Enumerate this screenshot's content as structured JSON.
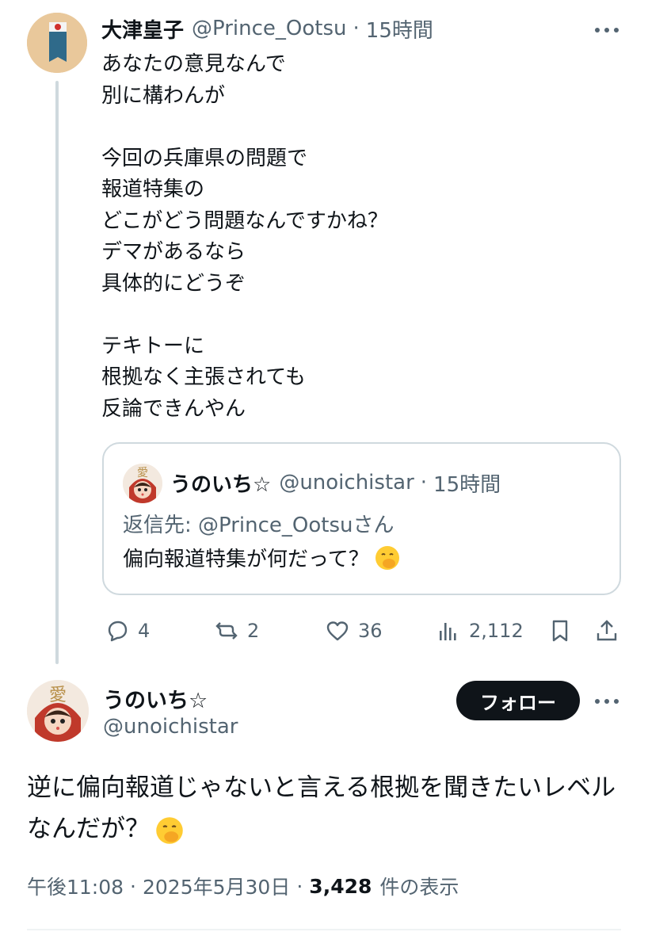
{
  "parent_tweet": {
    "author_name": "大津皇子",
    "handle": "@Prince_Ootsu",
    "separator": "·",
    "time": "15時間",
    "body_lines": [
      "あなたの意見なんで",
      "別に構わんが",
      "",
      "今回の兵庫県の問題で",
      "報道特集の",
      "どこがどう問題なんですかね？",
      "デマがあるなら",
      "具体的にどうぞ",
      "",
      "テキトーに",
      "根拠なく主張されても",
      "反論できんやん"
    ],
    "quote": {
      "author_name": "うのいち☆",
      "handle": "@unoichistar",
      "separator": "·",
      "time": "15時間",
      "reply_to": "返信先: @Prince_Ootsuさん",
      "text": "偏向報道特集が何だって？",
      "emoji": "hand-over-mouth-emoji"
    },
    "actions": {
      "replies": "4",
      "reposts": "2",
      "likes": "36",
      "views": "2,112"
    }
  },
  "main_tweet": {
    "author_name": "うのいち☆",
    "handle": "@unoichistar",
    "follow_label": "フォロー",
    "body": "逆に偏向報道じゃないと言える根拠を聞きたいレベルなんだが？",
    "emoji": "hand-over-mouth-emoji",
    "time": "午後11:08",
    "separator": "·",
    "date": "2025年5月30日",
    "views_count": "3,428",
    "views_label": "件の表示"
  },
  "colors": {
    "text": "#0f1419",
    "muted": "#536471",
    "border": "#cfd9de",
    "button": "#0f1419"
  }
}
